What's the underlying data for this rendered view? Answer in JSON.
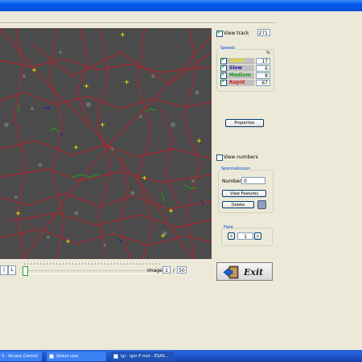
{
  "track": {
    "view_track_label": "View track",
    "track_count": "271"
  },
  "speeds": {
    "title": "Speeds",
    "percent_header": "%",
    "rows": [
      {
        "name": "Static",
        "percent": "17",
        "color": "#e6e600"
      },
      {
        "name": "Slow",
        "percent": "6",
        "color": "#1a1aa6"
      },
      {
        "name": "Medium",
        "percent": "8",
        "color": "#1f9a1f"
      },
      {
        "name": "Rapid",
        "percent": "67",
        "color": "#d01f1f"
      }
    ]
  },
  "properties_label": "Properties",
  "view_numbers_label": "View numbers",
  "spermatozoon": {
    "title": "Spermatozoon",
    "number_label": "Number",
    "number_value": "0",
    "view_features_label": "View Features",
    "delete_label": "Delete"
  },
  "field": {
    "title": "Field",
    "value": "1",
    "prev": "<",
    "next": ">"
  },
  "image_nav": {
    "label": "Image",
    "current": "1",
    "separator": "/",
    "total": "50",
    "btn_first": "|",
    "btn_last": "L"
  },
  "exit_label": "Exit",
  "taskbar": {
    "items": [
      "S - Access Control",
      "Select user",
      "igi - igor P mot - ESAS..."
    ]
  },
  "colors": {
    "accent": "#0046d5",
    "track_line": "#c81e2a",
    "viewport_bg": "#4a4a4a"
  }
}
